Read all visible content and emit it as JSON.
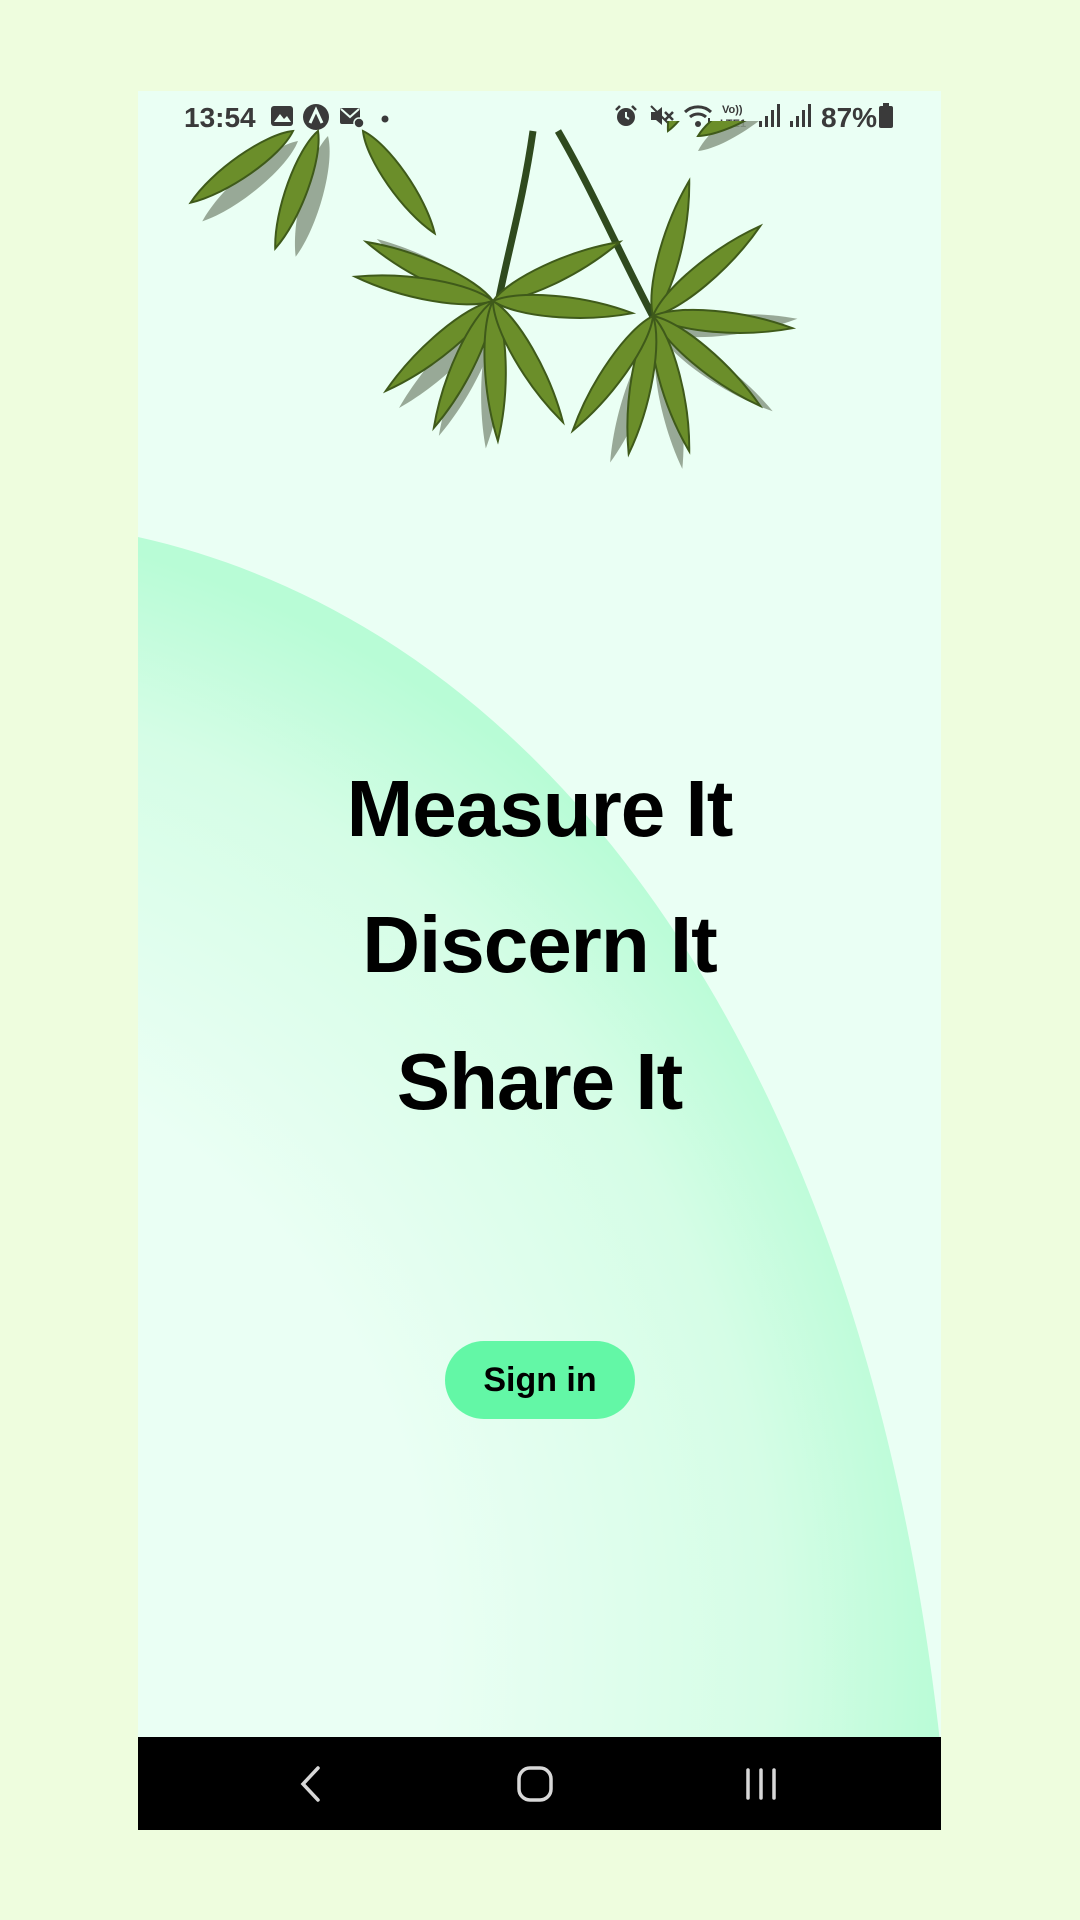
{
  "status_bar": {
    "time": "13:54",
    "battery": "87%",
    "icons": [
      "gallery-icon",
      "a-badge-icon",
      "mail-icon",
      "notification-dot-icon",
      "alarm-icon",
      "mute-icon",
      "wifi-icon",
      "volte-icon",
      "signal-icon",
      "signal-icon",
      "battery-icon"
    ],
    "volte_text": "Vo)) LTE1"
  },
  "hero": {
    "illustration": "palm-leaves"
  },
  "tagline": {
    "line1": "Measure It",
    "line2": "Discern It",
    "line3": "Share It"
  },
  "signin_label": "Sign in",
  "nav": {
    "back": "back-icon",
    "home": "home-icon",
    "recents": "recents-icon"
  },
  "colors": {
    "page_bg": "#eefdde",
    "screen_bg": "#eafff4",
    "arc": "#b6fcd5",
    "button": "#63f7a6",
    "leaf": "#6b8e2a",
    "leaf_shadow": "#8a9a86"
  }
}
